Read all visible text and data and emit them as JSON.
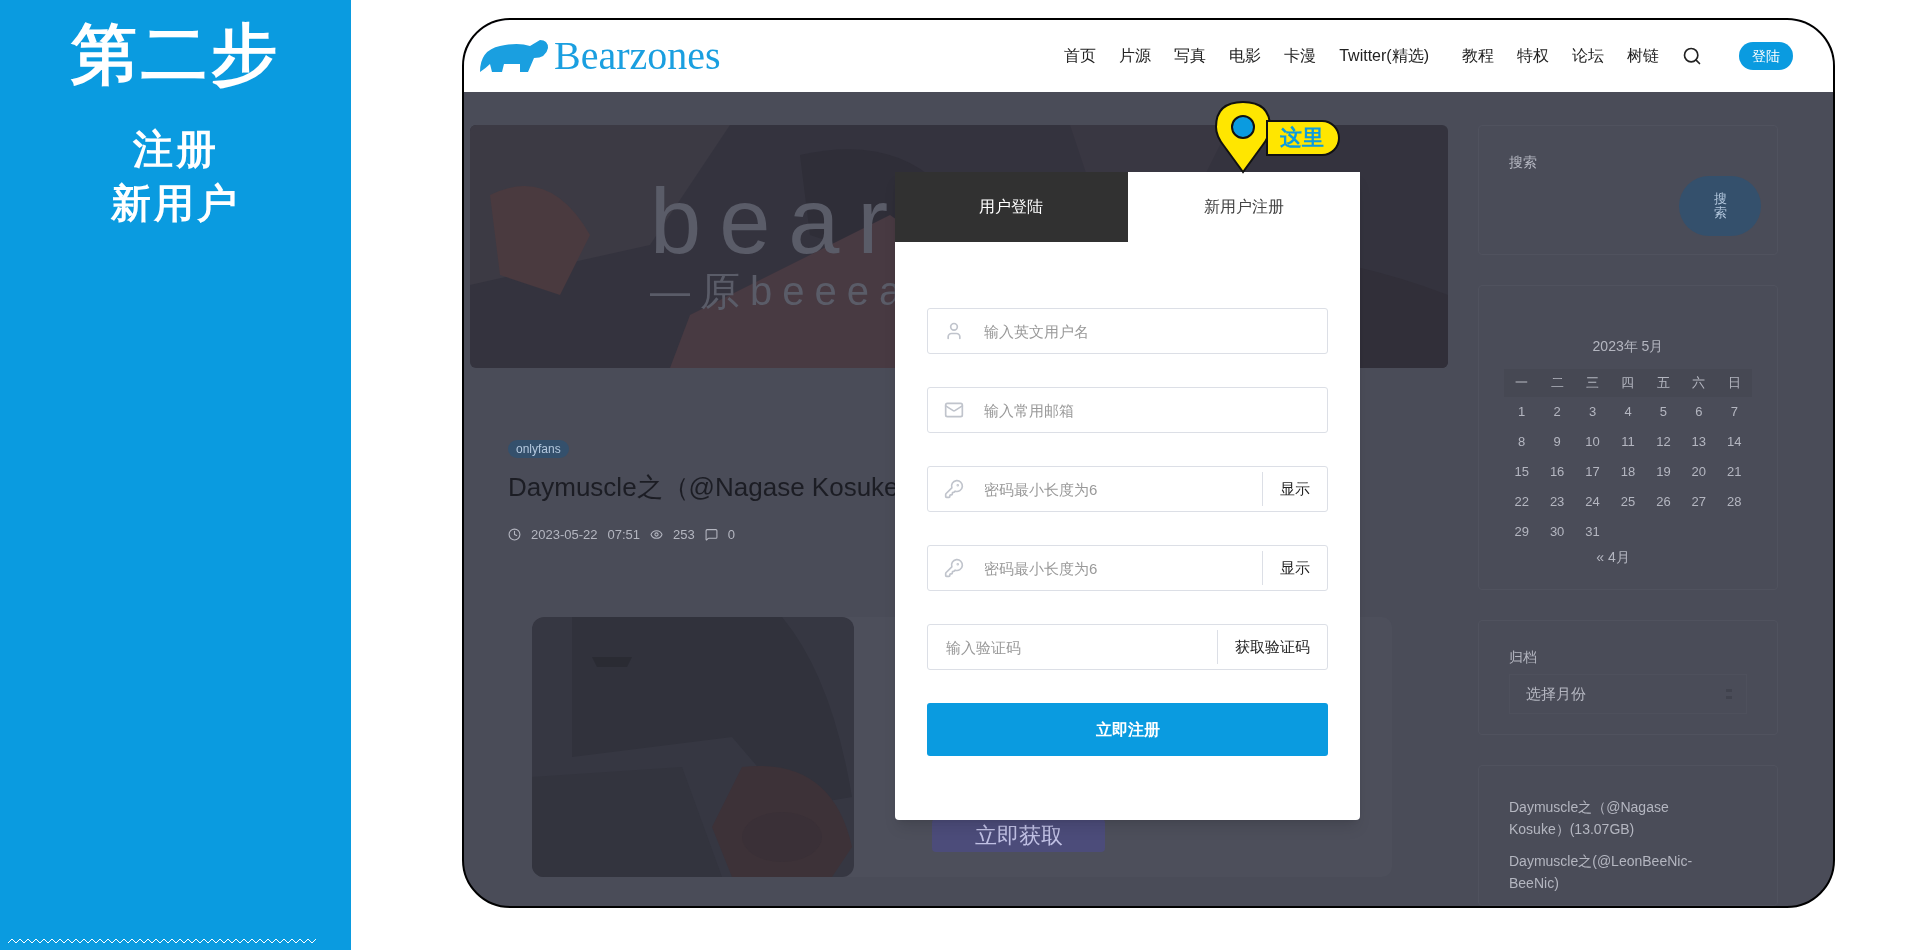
{
  "step_panel": {
    "title": "第二步",
    "lines": [
      "注册",
      "新用户"
    ]
  },
  "site": {
    "logo": "Bearzones",
    "nav": [
      "首页",
      "片源",
      "写真",
      "电影",
      "卡漫",
      "Twitter(精选)",
      "教程",
      "特权",
      "论坛",
      "树链"
    ],
    "login": "登陆"
  },
  "banner": {
    "title": "bear",
    "subtitle": "—原beeea"
  },
  "post": {
    "tag": "onlyfans",
    "title": "Daymuscle之（@Nagase Kosuke",
    "date": "2023-05-22",
    "time": "07:51",
    "views": "253",
    "comments": "0",
    "cta": "立即获取"
  },
  "sidebar": {
    "search": {
      "label": "搜索",
      "button": "搜索"
    },
    "calendar": {
      "caption": "2023年 5月",
      "weekdays": [
        "一",
        "二",
        "三",
        "四",
        "五",
        "六",
        "日"
      ],
      "weeks": [
        [
          "1",
          "2",
          "3",
          "4",
          "5",
          "6",
          "7"
        ],
        [
          "8",
          "9",
          "10",
          "11",
          "12",
          "13",
          "14"
        ],
        [
          "15",
          "16",
          "17",
          "18",
          "19",
          "20",
          "21"
        ],
        [
          "22",
          "23",
          "24",
          "25",
          "26",
          "27",
          "28"
        ],
        [
          "29",
          "30",
          "31"
        ]
      ],
      "prev": "« 4月"
    },
    "archive": {
      "label": "归档",
      "select": "选择月份"
    },
    "recent": [
      "Daymuscle之（@Nagase Kosuke）(13.07GB)",
      "Daymuscle之(@LeonBeeNic-BeeNic)"
    ]
  },
  "modal": {
    "tabs": [
      {
        "label": "用户登陆",
        "selected": false
      },
      {
        "label": "新用户注册",
        "selected": true
      }
    ],
    "fields": [
      {
        "kind": "user",
        "placeholder": "输入英文用户名"
      },
      {
        "kind": "mail",
        "placeholder": "输入常用邮箱"
      },
      {
        "kind": "password",
        "placeholder": "密码最小长度为6",
        "action": "显示"
      },
      {
        "kind": "password",
        "placeholder": "密码最小长度为6",
        "action": "显示"
      },
      {
        "kind": "code",
        "placeholder": "输入验证码",
        "action": "获取验证码"
      }
    ],
    "submit": "立即注册"
  },
  "callout": {
    "label": "这里"
  }
}
